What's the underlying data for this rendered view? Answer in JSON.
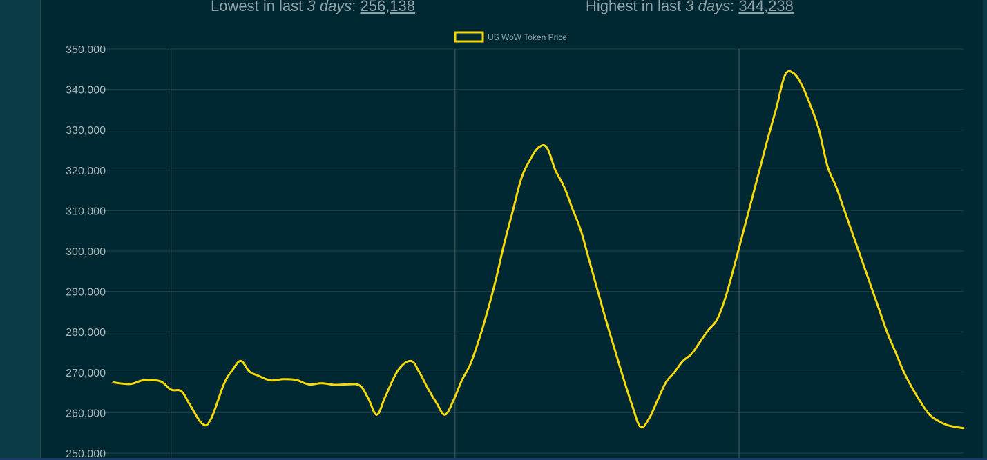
{
  "stats": {
    "lowest": {
      "prefix": "Lowest in last ",
      "period": "3 days",
      "sep": ": ",
      "value": "256,138"
    },
    "highest": {
      "prefix": "Highest in last ",
      "period": "3 days",
      "sep": ": ",
      "value": "344,238"
    }
  },
  "colors": {
    "line": "#f5d90a",
    "grid": "#1d3f46",
    "vgrid": "#4a5e63",
    "tick_text": "#a9b7bb",
    "panel": "#002833"
  },
  "chart_data": {
    "type": "line",
    "title": "",
    "xlabel": "",
    "ylabel": "",
    "legend": {
      "position": "top-center",
      "entries": [
        "US WoW Token Price"
      ]
    },
    "ylim": [
      250000,
      350000
    ],
    "yticks": [
      250000,
      260000,
      270000,
      280000,
      290000,
      300000,
      310000,
      320000,
      330000,
      340000,
      350000
    ],
    "ytick_labels": [
      "250,000",
      "260,000",
      "270,000",
      "280,000",
      "290,000",
      "300,000",
      "310,000",
      "320,000",
      "330,000",
      "340,000",
      "350,000"
    ],
    "xlim": [
      0,
      100
    ],
    "x_gridlines": [
      6.8,
      40.2,
      73.6
    ],
    "grid": true,
    "series": [
      {
        "name": "US WoW Token Price",
        "x": [
          0,
          2,
          3.5,
          5.5,
          6.8,
          8,
          9,
          10.5,
          11.5,
          13,
          14,
          15,
          16,
          17,
          18.5,
          20,
          21.5,
          23,
          24.5,
          26,
          27.5,
          29,
          30,
          31,
          32,
          33.5,
          35,
          36,
          37,
          38,
          39,
          40,
          41,
          42,
          43,
          44,
          45,
          46,
          47,
          48,
          49,
          50,
          51,
          52,
          53,
          54,
          55,
          56,
          57,
          58,
          59,
          60,
          61,
          62,
          63,
          64,
          65,
          66,
          67,
          68,
          69,
          70,
          71,
          72,
          73,
          74,
          75,
          76,
          77,
          78,
          79,
          80,
          81,
          82,
          83,
          84,
          85,
          86,
          87,
          88,
          89,
          90,
          91,
          92,
          93,
          94,
          95,
          96,
          97,
          98,
          99,
          100
        ],
        "y": [
          267500,
          267100,
          268000,
          267800,
          265700,
          265300,
          262000,
          257200,
          258500,
          267000,
          270500,
          272800,
          270200,
          269200,
          268000,
          268300,
          268100,
          267000,
          267300,
          266900,
          267000,
          266700,
          263500,
          259500,
          264000,
          270500,
          272800,
          270000,
          266000,
          262500,
          259500,
          263000,
          268000,
          272000,
          278000,
          285000,
          293000,
          302000,
          310000,
          318000,
          322500,
          325600,
          325600,
          320000,
          316000,
          310500,
          305000,
          297500,
          290000,
          282500,
          275500,
          268500,
          262000,
          256500,
          258500,
          263000,
          267500,
          270000,
          272800,
          274500,
          277500,
          280500,
          283000,
          288500,
          296000,
          304000,
          312000,
          320000,
          328000,
          335500,
          343500,
          344000,
          341000,
          336000,
          330000,
          321000,
          316000,
          310000,
          304000,
          298000,
          292000,
          286000,
          280000,
          275000,
          270000,
          266000,
          262500,
          259500,
          258000,
          257000,
          256500,
          256200
        ]
      }
    ]
  }
}
